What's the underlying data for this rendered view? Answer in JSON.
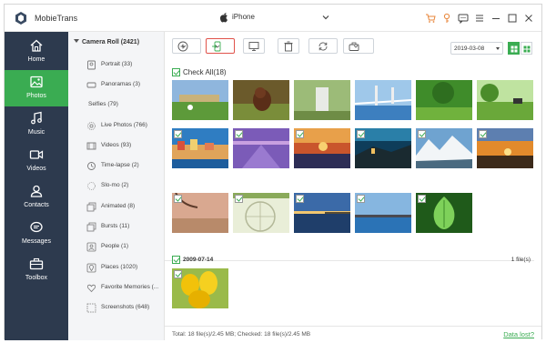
{
  "app": {
    "title": "MobieTrans"
  },
  "device": {
    "name": "iPhone"
  },
  "nav": {
    "items": [
      {
        "label": "Home"
      },
      {
        "label": "Photos"
      },
      {
        "label": "Music"
      },
      {
        "label": "Videos"
      },
      {
        "label": "Contacts"
      },
      {
        "label": "Messages"
      },
      {
        "label": "Toolbox"
      }
    ]
  },
  "folders": {
    "root": "Camera Roll (2421)",
    "items": [
      {
        "label": "Portrait (33)",
        "icon": "portrait-icon"
      },
      {
        "label": "Panoramas (3)",
        "icon": "panorama-icon"
      },
      {
        "label": "Selfies (79)",
        "icon": ""
      },
      {
        "label": "Live Photos (766)",
        "icon": "live-photos-icon"
      },
      {
        "label": "Videos (93)",
        "icon": "videos-icon"
      },
      {
        "label": "Time-lapse (2)",
        "icon": "time-lapse-icon"
      },
      {
        "label": "Slo-mo (2)",
        "icon": "slo-mo-icon"
      },
      {
        "label": "Animated (8)",
        "icon": "animated-icon"
      },
      {
        "label": "Bursts (11)",
        "icon": "bursts-icon"
      },
      {
        "label": "People (1)",
        "icon": "people-icon"
      },
      {
        "label": "Places (1020)",
        "icon": "places-icon"
      },
      {
        "label": "Favorite Memories (...",
        "icon": "heart-icon"
      },
      {
        "label": "Screenshots (648)",
        "icon": "screenshots-icon"
      }
    ]
  },
  "toolbar": {
    "date": "2019-03-08"
  },
  "grid": {
    "check_all": "Check All(18)"
  },
  "group": {
    "date": "2009-07-14",
    "count": "1 file(s)"
  },
  "status": {
    "summary": "Total: 18 file(s)/2.45 MB; Checked: 18 file(s)/2.45 MB",
    "data_lost": "Data lost?"
  },
  "colors": {
    "accent": "#3aac52",
    "nav_bg": "#2d3a4e",
    "selected_border": "#e0524a"
  }
}
